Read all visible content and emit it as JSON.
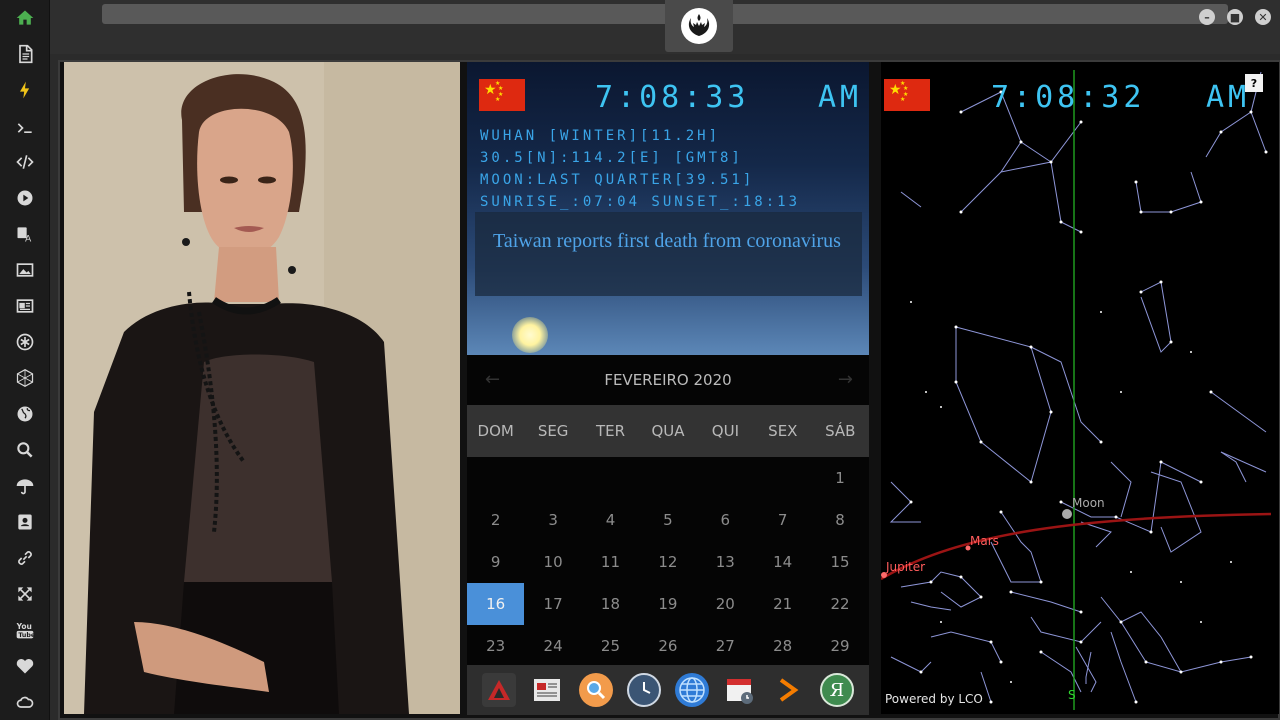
{
  "sidebar": {
    "items": [
      {
        "name": "home-icon"
      },
      {
        "name": "document-icon"
      },
      {
        "name": "lightning-icon"
      },
      {
        "name": "terminal-icon"
      },
      {
        "name": "code-icon"
      },
      {
        "name": "play-icon"
      },
      {
        "name": "translate-icon"
      },
      {
        "name": "image-icon"
      },
      {
        "name": "news-icon"
      },
      {
        "name": "asterisk-icon"
      },
      {
        "name": "hexagon-icon"
      },
      {
        "name": "globe-icon"
      },
      {
        "name": "search-icon"
      },
      {
        "name": "umbrella-icon"
      },
      {
        "name": "contact-icon"
      },
      {
        "name": "link-icon"
      },
      {
        "name": "expand-icon"
      },
      {
        "name": "youtube-icon",
        "label": "You Tube"
      },
      {
        "name": "heart-icon"
      },
      {
        "name": "cloud-icon"
      }
    ],
    "accent": "#4caf50"
  },
  "window": {
    "controls": [
      "minimize",
      "maximize",
      "close"
    ]
  },
  "clock_left": {
    "time": "7:08:33",
    "ampm": "AM",
    "lines": [
      "WUHAN [WINTER][11.2H]",
      "30.5[N]:114.2[E] [GMT8]",
      "MOON:LAST QUARTER[39.51]",
      "SUNRISE_:07:04 SUNSET_:18:13"
    ],
    "news": "Taiwan reports first death from coronavirus"
  },
  "clock_right": {
    "time": "7:08:32",
    "ampm": "AM"
  },
  "calendar": {
    "month": "FEVEREIRO 2020",
    "weekdays": [
      "DOM",
      "SEG",
      "TER",
      "QUA",
      "QUI",
      "SEX",
      "SÁB"
    ],
    "weeks": [
      [
        "",
        "",
        "",
        "",
        "",
        "",
        "1"
      ],
      [
        "2",
        "3",
        "4",
        "5",
        "6",
        "7",
        "8"
      ],
      [
        "9",
        "10",
        "11",
        "12",
        "13",
        "14",
        "15"
      ],
      [
        "16",
        "17",
        "18",
        "19",
        "20",
        "21",
        "22"
      ],
      [
        "23",
        "24",
        "25",
        "26",
        "27",
        "28",
        "29"
      ]
    ],
    "today": "16",
    "today_color": "#4a90d9"
  },
  "dock": {
    "apps": [
      "arrow-app-icon",
      "news-app-icon",
      "search-app-icon",
      "clock-app-icon",
      "globe-app-icon",
      "calendar-app-icon",
      "forward-app-icon",
      "yandex-app-icon"
    ]
  },
  "sky": {
    "labels": {
      "moon": "Moon",
      "mars": "Mars",
      "jupiter": "Jupiter",
      "south": "S"
    },
    "help": "?",
    "powered": "Powered by LCO"
  }
}
